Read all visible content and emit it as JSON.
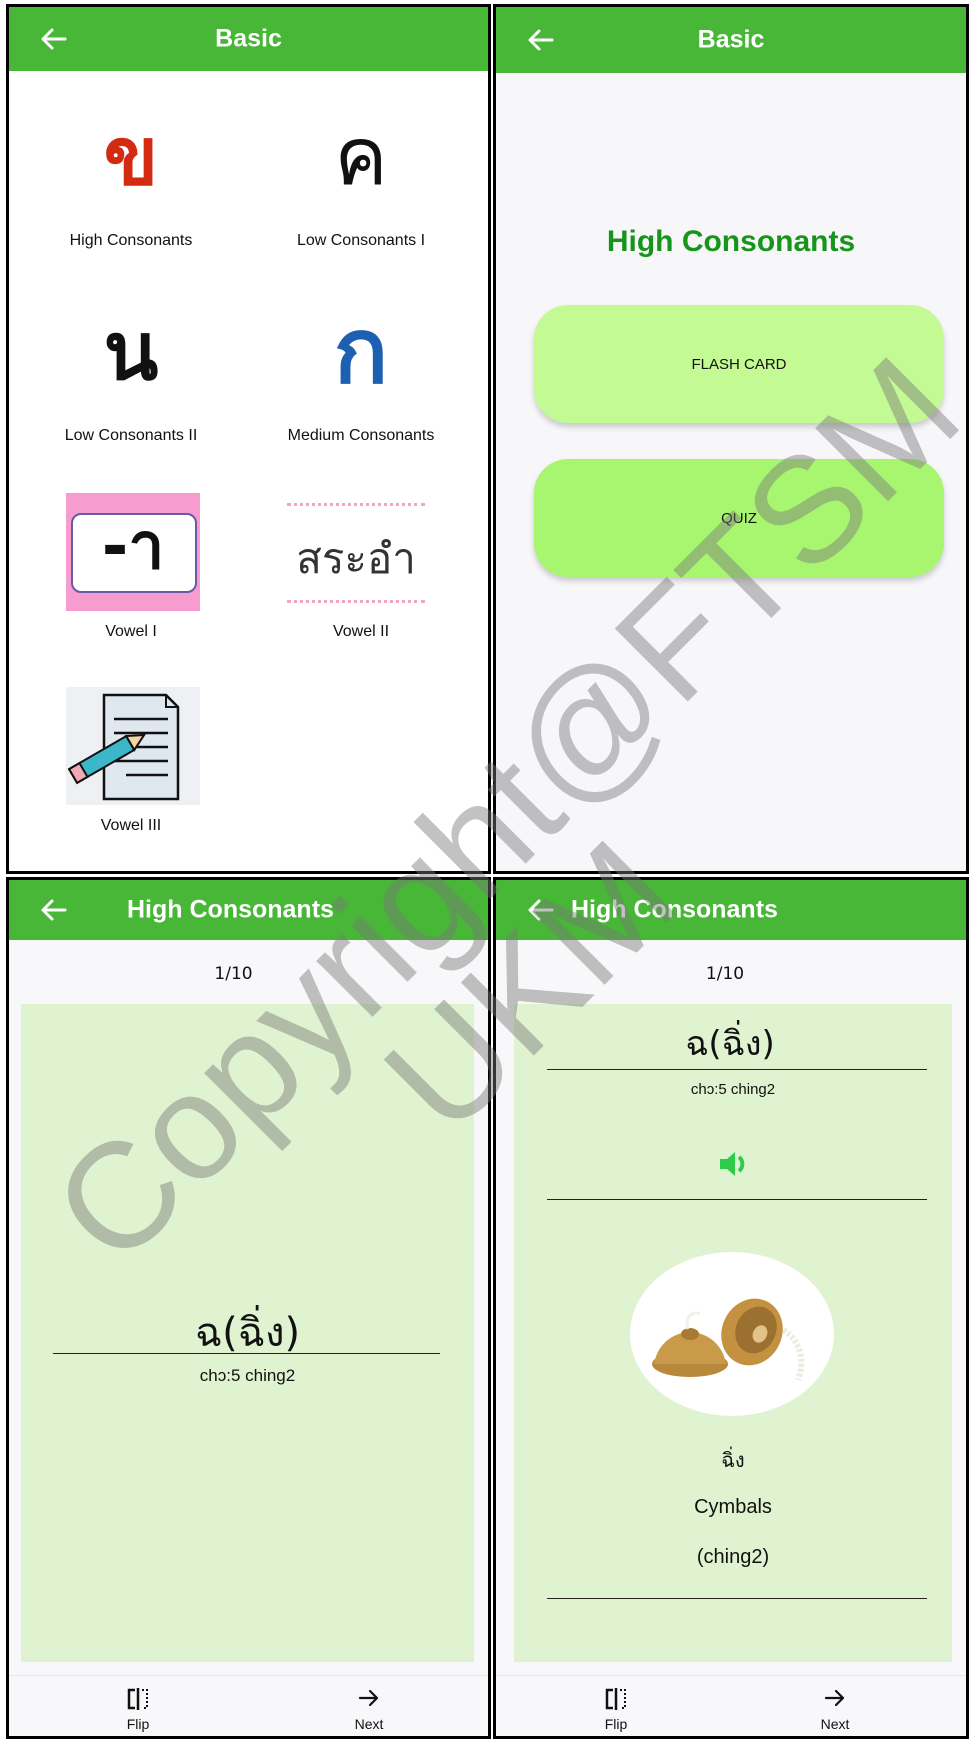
{
  "panel1": {
    "title": "Basic",
    "categories": [
      {
        "glyph": "ข",
        "label": "High Consonants",
        "color": "#d32a12"
      },
      {
        "glyph": "ค",
        "label": "Low Consonants I",
        "color": "#111111"
      },
      {
        "glyph": "น",
        "label": "Low Consonants II",
        "color": "#111111"
      },
      {
        "glyph": "ก",
        "label": "Medium Consonants",
        "color": "#1d5fb0"
      },
      {
        "glyph": "-า",
        "label": "Vowel I",
        "color": "#111111"
      },
      {
        "glyph": "สระอำ",
        "label": "Vowel II",
        "color": "#333333"
      },
      {
        "glyph": "",
        "label": "Vowel III",
        "color": "#111111"
      }
    ]
  },
  "panel2": {
    "title": "Basic",
    "heading": "High Consonants",
    "buttons": [
      {
        "label": "FLASH CARD",
        "color": "#c4fa94"
      },
      {
        "label": "QUIZ",
        "color": "#a8f66f"
      }
    ]
  },
  "panel3": {
    "title": "High Consonants",
    "counter": "1/10",
    "thai": "ฉ(ฉิ่ง)",
    "romanization": "chɔ:5 ching2",
    "nav": {
      "flip": "Flip",
      "next": "Next"
    }
  },
  "panel4": {
    "title": "High Consonants",
    "counter": "1/10",
    "thai": "ฉ(ฉิ่ง)",
    "romanization": "chɔ:5 ching2",
    "word_thai": "ฉิ่ง",
    "word_english": "Cymbals",
    "word_roman": "(ching2)",
    "speaker_icon": "speaker-icon",
    "nav": {
      "flip": "Flip",
      "next": "Next"
    }
  },
  "watermark": {
    "line1": "Copyright@FTSM",
    "line2": "UKM"
  },
  "colors": {
    "appbar": "#48b637",
    "card": "#dff3d0",
    "heading_green": "#17951b",
    "speaker": "#2ecc4a"
  }
}
